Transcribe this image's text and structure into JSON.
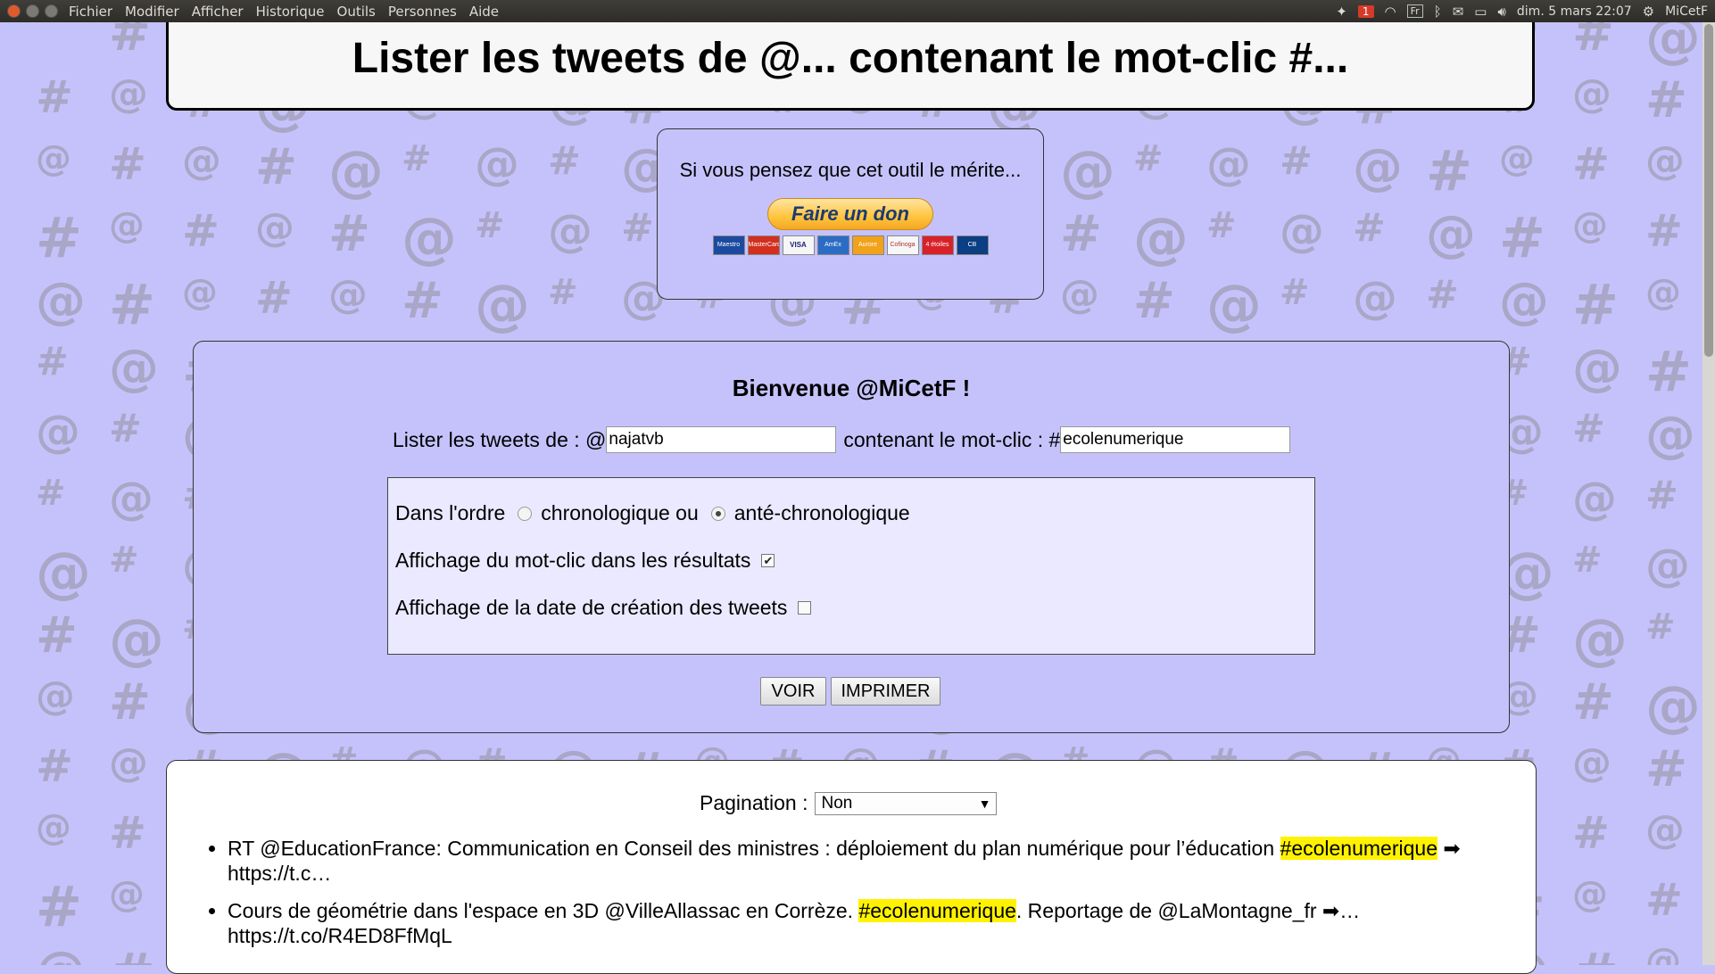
{
  "menubar": {
    "items": [
      "Fichier",
      "Modifier",
      "Afficher",
      "Historique",
      "Outils",
      "Personnes",
      "Aide"
    ],
    "notification_count": "1",
    "keyboard_layout": "Fr",
    "datetime": "dim. 5 mars 22:07",
    "user": "MiCetF"
  },
  "page": {
    "title": "Lister les tweets de @... contenant le mot-clic #..."
  },
  "donate": {
    "prompt": "Si vous pensez que cet outil le mérite...",
    "button_label": "Faire un don",
    "cards": [
      "Maestro",
      "MasterCard",
      "VISA",
      "AmEx",
      "Aurore",
      "Cofinoga",
      "4 étoiles",
      "CB"
    ]
  },
  "form": {
    "welcome": "Bienvenue @MiCetF !",
    "user_label": "Lister les tweets de : @",
    "user_value": "najatvb",
    "tag_label": "contenant le mot-clic : #",
    "tag_value": "ecolenumerique",
    "order_label": "Dans l'ordre",
    "order_option1": "chronologique ou",
    "order_option2": "anté-chronologique",
    "order_selected": "anté-chronologique",
    "show_tag_label": "Affichage du mot-clic dans les résultats",
    "show_tag_checked": true,
    "show_date_label": "Affichage de la date de création des tweets",
    "show_date_checked": false,
    "voir_label": "VOIR",
    "print_label": "IMPRIMER"
  },
  "results": {
    "pagination_label": "Pagination :",
    "pagination_value": "Non",
    "tweets": [
      {
        "before": "RT @EducationFrance: Communication en Conseil des ministres : déploiement du plan numérique pour l’éducation ",
        "tag": "#ecolenumerique",
        "after": " ➡ https://t.c…"
      },
      {
        "before": "Cours de géométrie dans l'espace en 3D @VilleAllassac en Corrèze. ",
        "tag": "#ecolenumerique",
        "after": ". Reportage de @LaMontagne_fr ➡… https://t.co/R4ED8FfMqL"
      }
    ]
  },
  "colors": {
    "background": "#c5c2fb",
    "highlight": "#fff200",
    "pattern": "#a9a6c7"
  }
}
